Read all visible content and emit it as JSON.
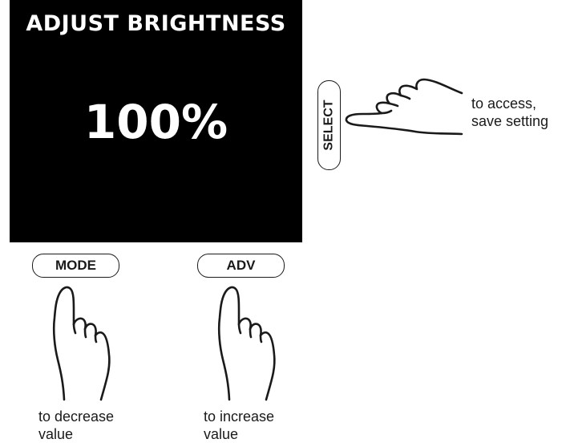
{
  "screen": {
    "title": "ADJUST BRIGHTNESS",
    "value": "100%"
  },
  "buttons": {
    "select_label": "SELECT",
    "mode_label": "MODE",
    "adv_label": "ADV"
  },
  "captions": {
    "select": [
      "to access,",
      "save setting"
    ],
    "mode": [
      "to decrease",
      "value"
    ],
    "adv": [
      "to increase",
      "value"
    ]
  },
  "icons": [
    "hand-pointing-left-icon",
    "hand-pointing-up-icon",
    "hand-pointing-up-icon"
  ],
  "colors": {
    "screen_background": "#000000",
    "screen_text": "#ffffff",
    "line": "#1a1a1a"
  }
}
